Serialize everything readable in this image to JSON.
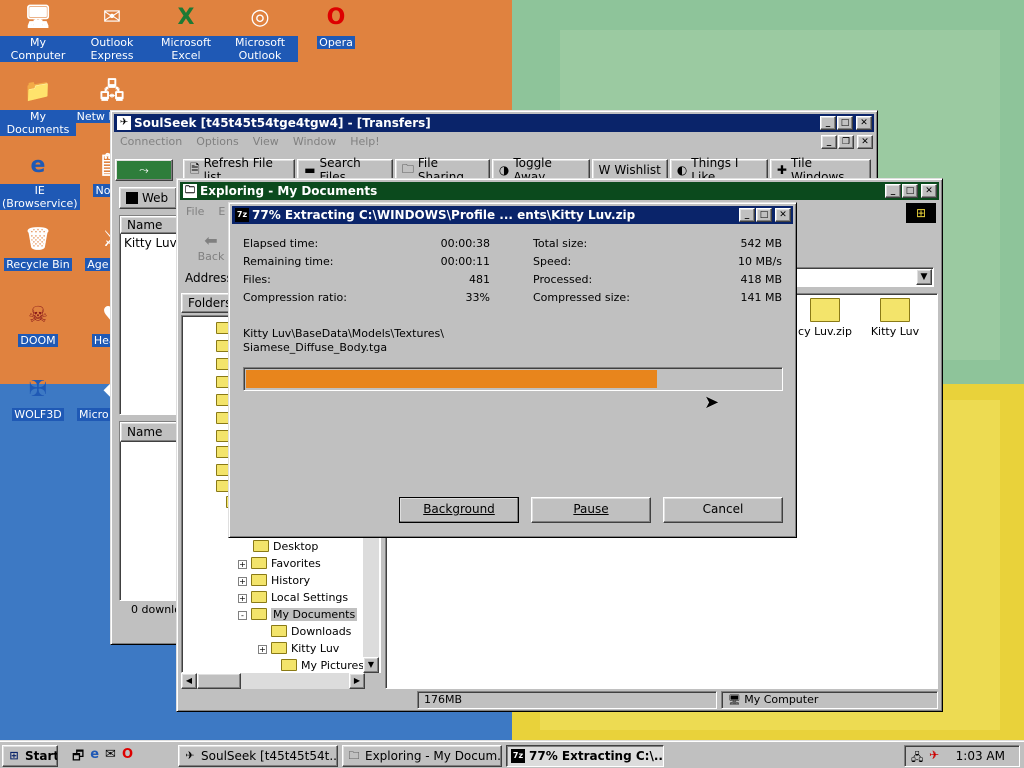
{
  "desktop": {
    "icons": [
      {
        "label": "My Computer",
        "icon": "my-computer-icon",
        "glyph": "🖥"
      },
      {
        "label": "Outlook Express",
        "icon": "outlook-express-icon",
        "glyph": "✉"
      },
      {
        "label": "Microsoft Excel",
        "icon": "excel-icon",
        "glyph": "X"
      },
      {
        "label": "Microsoft Outlook",
        "icon": "outlook-icon",
        "glyph": "◎"
      },
      {
        "label": "Opera",
        "icon": "opera-icon",
        "glyph": "O"
      },
      {
        "label": "My Documents",
        "icon": "my-documents-icon",
        "glyph": "📁"
      },
      {
        "label": "Network Neighborhood",
        "display": "Netw Neighb",
        "icon": "network-icon",
        "glyph": "🖧"
      },
      {
        "label": "IE (Browservice)",
        "icon": "ie-icon",
        "glyph": "e"
      },
      {
        "label": "Notepad",
        "display": "Notep",
        "icon": "notepad-icon",
        "glyph": "🗒"
      },
      {
        "label": "Recycle Bin",
        "icon": "recycle-bin-icon",
        "glyph": "🗑"
      },
      {
        "label": "Age of Empires",
        "display": "Age Emp",
        "icon": "age-of-empires-icon",
        "glyph": "⚔"
      },
      {
        "label": "DOOM",
        "icon": "doom-icon",
        "glyph": "☠"
      },
      {
        "label": "Hearts",
        "display": "Hearts",
        "icon": "hearts-icon",
        "glyph": "♥"
      },
      {
        "label": "WOLF3D",
        "icon": "wolf3d-icon",
        "glyph": "✠"
      },
      {
        "label": "Microsoft Visual",
        "display": "Micro Visual",
        "icon": "visual-icon",
        "glyph": "◆"
      }
    ]
  },
  "soulseek": {
    "title": "SoulSeek [t45t45t54tge4tgw4] - [Transfers]",
    "menu": [
      "Connection",
      "Options",
      "View",
      "Window",
      "Help!"
    ],
    "toolbar": [
      "Refresh File list",
      "Search Files",
      "File Sharing",
      "Toggle Away",
      "Wishlist",
      "Things I Like",
      "Tile Windows"
    ],
    "web_label": "Web",
    "col_name": "Name",
    "row1": "Kitty Luv",
    "col_name2": "Name",
    "status": "0 downlo"
  },
  "explorer": {
    "title": "Exploring - My Documents",
    "menu": [
      "File",
      "E"
    ],
    "back_label": "Back",
    "address_label": "Address",
    "folders_label": "Folders",
    "tree": [
      {
        "label": "Desktop",
        "pm": ""
      },
      {
        "label": "Favorites",
        "pm": "+"
      },
      {
        "label": "History",
        "pm": "+"
      },
      {
        "label": "Local Settings",
        "pm": "+"
      },
      {
        "label": "My Documents",
        "pm": "-"
      },
      {
        "label": "Downloads",
        "pm": ""
      },
      {
        "label": "Kitty Luv",
        "pm": "+"
      },
      {
        "label": "My Pictures",
        "pm": ""
      }
    ],
    "files": [
      {
        "label": "cy Luv.zip"
      },
      {
        "label": "Kitty Luv"
      }
    ],
    "status_size": "176MB",
    "status_zone": "My Computer"
  },
  "extract": {
    "title": "77% Extracting C:\\WINDOWS\\Profile ... ents\\Kitty Luv.zip",
    "left": [
      {
        "label": "Elapsed time:",
        "value": "00:00:38"
      },
      {
        "label": "Remaining time:",
        "value": "00:00:11"
      },
      {
        "label": "Files:",
        "value": "481"
      },
      {
        "label": "Compression ratio:",
        "value": "33%"
      }
    ],
    "right": [
      {
        "label": "Total size:",
        "value": "542 MB"
      },
      {
        "label": "Speed:",
        "value": "10 MB/s"
      },
      {
        "label": "Processed:",
        "value": "418 MB"
      },
      {
        "label": "Compressed size:",
        "value": "141 MB"
      }
    ],
    "path_line1": "Kitty Luv\\BaseData\\Models\\Textures\\",
    "path_line2": "Siamese_Diffuse_Body.tga",
    "progress": 0.77,
    "progress_color": "#e8851c",
    "buttons": {
      "background": "Background",
      "pause": "Pause",
      "cancel": "Cancel"
    }
  },
  "taskbar": {
    "start": "Start",
    "tasks": [
      {
        "label": "SoulSeek [t45t45t54t...",
        "icon": "soulseek-icon"
      },
      {
        "label": "Exploring - My Docum...",
        "icon": "explorer-icon"
      },
      {
        "label": "77% Extracting C:\\...",
        "icon": "7zip-icon"
      }
    ],
    "clock": "1:03 AM"
  }
}
